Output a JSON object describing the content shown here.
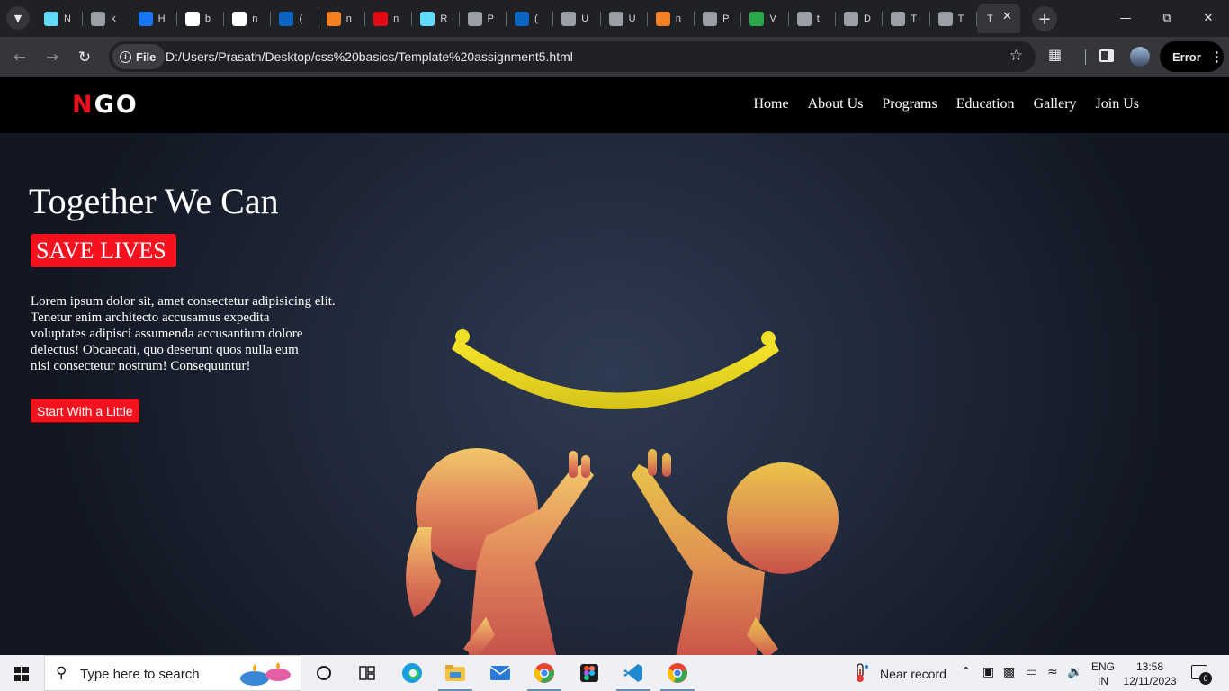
{
  "browser": {
    "tabs": [
      {
        "favicon": "react-icon",
        "color": "#61dafb",
        "label": "N"
      },
      {
        "favicon": "react-icon",
        "color": "#9aa0a6",
        "label": "k"
      },
      {
        "favicon": "h-icon",
        "color": "#1877f2",
        "label": "H"
      },
      {
        "favicon": "google-icon",
        "color": "#ffffff",
        "label": "b"
      },
      {
        "favicon": "google-icon",
        "color": "#ffffff",
        "label": "n"
      },
      {
        "favicon": "linkedin-icon",
        "color": "#0a66c2",
        "label": "("
      },
      {
        "favicon": "stackoverflow-icon",
        "color": "#f48024",
        "label": "n"
      },
      {
        "favicon": "n-icon",
        "color": "#e50914",
        "label": "n"
      },
      {
        "favicon": "react-icon",
        "color": "#61dafb",
        "label": "R"
      },
      {
        "favicon": "github-icon",
        "color": "#9aa0a6",
        "label": "P"
      },
      {
        "favicon": "linkedin-icon",
        "color": "#0a66c2",
        "label": "("
      },
      {
        "favicon": "globe-icon",
        "color": "#9aa0a6",
        "label": "U"
      },
      {
        "favicon": "globe-icon",
        "color": "#9aa0a6",
        "label": "U"
      },
      {
        "favicon": "stackoverflow-icon",
        "color": "#f48024",
        "label": "n"
      },
      {
        "favicon": "github-icon",
        "color": "#9aa0a6",
        "label": "P"
      },
      {
        "favicon": "w-icon",
        "color": "#2aa84a",
        "label": "V"
      },
      {
        "favicon": "globe-icon",
        "color": "#9aa0a6",
        "label": "t"
      },
      {
        "favicon": "globe-icon",
        "color": "#9aa0a6",
        "label": "D"
      },
      {
        "favicon": "globe-icon",
        "color": "#9aa0a6",
        "label": "T"
      },
      {
        "favicon": "globe-icon",
        "color": "#9aa0a6",
        "label": "T"
      }
    ],
    "active_tab_label": "T",
    "chip_label": "File",
    "url": "D:/Users/Prasath/Desktop/css%20basics/Template%20assignment5.html",
    "error_label": "Error"
  },
  "site": {
    "logo_first": "N",
    "logo_rest": "GO",
    "nav": [
      "Home",
      "About Us",
      "Programs",
      "Education",
      "Gallery",
      "Join Us"
    ],
    "hero_title": "Together We Can",
    "hero_badge": "SAVE LIVES",
    "hero_lines": [
      "Lorem ipsum dolor sit, amet consectetur adipisicing elit.",
      "Tenetur enim architecto accusamus expedita",
      "voluptates adipisci assumenda accusantium dolore",
      "delectus! Obcaecati, quo deserunt quos nulla eum",
      "nisi consectetur nostrum! Consequuntur!"
    ],
    "cta_label": "Start With a Little",
    "accent": "#f4121e"
  },
  "taskbar": {
    "search_placeholder": "Type here to search",
    "weather": "Near record",
    "lang_top": "ENG",
    "lang_bottom": "IN",
    "time": "13:58",
    "date": "12/11/2023",
    "notification_count": "6"
  }
}
